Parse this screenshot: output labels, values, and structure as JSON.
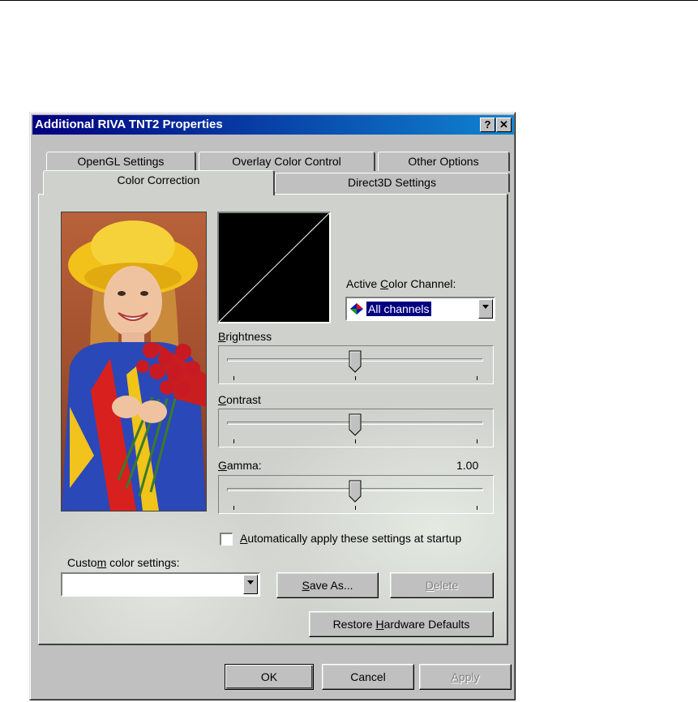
{
  "window": {
    "title": "Additional RIVA TNT2 Properties",
    "help_button": "?",
    "close_button": "✕"
  },
  "tabs_back": [
    "OpenGL Settings",
    "Overlay Color Control",
    "Other Options"
  ],
  "tabs_front": [
    "Color Correction",
    "Direct3D Settings"
  ],
  "active_tab": "Color Correction",
  "color": {
    "channel_label_pre": "Active ",
    "channel_label_u": "C",
    "channel_label_post": "olor Channel:",
    "channel_value": "All channels"
  },
  "sliders": {
    "brightness": {
      "label_u": "B",
      "label_rest": "rightness",
      "value": 0.5
    },
    "contrast": {
      "label_u": "C",
      "label_rest": "ontrast",
      "value": 0.5
    },
    "gamma": {
      "label_u": "G",
      "label_rest": "amma:",
      "value": 0.5,
      "readout": "1.00"
    }
  },
  "startup": {
    "label_u": "A",
    "label_rest": "utomatically apply these settings at startup",
    "checked": false
  },
  "custom": {
    "label_pre": "Custo",
    "label_u": "m",
    "label_post": " color settings:",
    "value": ""
  },
  "buttons": {
    "save_u": "S",
    "save_rest": "ave As...",
    "delete_u": "D",
    "delete_rest": "elete",
    "restore_pre": "Restore ",
    "restore_u": "H",
    "restore_post": "ardware Defaults",
    "ok": "OK",
    "cancel": "Cancel",
    "apply_u": "A",
    "apply_rest": "pply"
  }
}
